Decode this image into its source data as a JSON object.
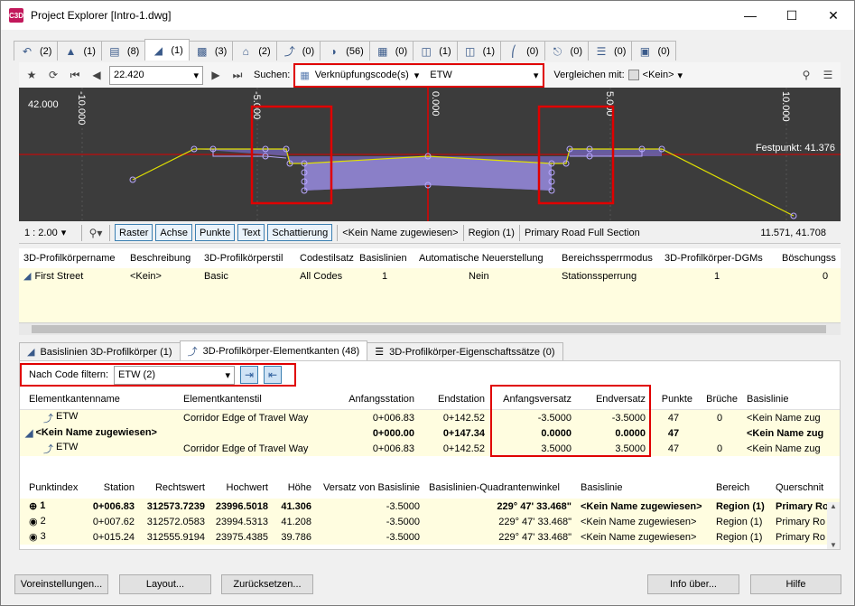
{
  "window": {
    "title": "Project Explorer [Intro-1.dwg]",
    "app_icon_text": "C3D"
  },
  "tabs": [
    {
      "icon": "alignment-icon",
      "count": "(2)"
    },
    {
      "icon": "profile-icon",
      "count": "(1)"
    },
    {
      "icon": "profile-view-icon",
      "count": "(8)"
    },
    {
      "icon": "corridor-icon",
      "count": "(1)"
    },
    {
      "icon": "assembly-icon",
      "count": "(3)"
    },
    {
      "icon": "surface-icon",
      "count": "(2)"
    },
    {
      "icon": "feature-line-icon",
      "count": "(0)"
    },
    {
      "icon": "point-icon",
      "count": "(56)"
    },
    {
      "icon": "parcel-icon",
      "count": "(0)"
    },
    {
      "icon": "pipe-network-icon",
      "count": "(1)"
    },
    {
      "icon": "pressure-network-icon",
      "count": "(1)"
    },
    {
      "icon": "sample-line-icon",
      "count": "(0)"
    },
    {
      "icon": "intersection-icon",
      "count": "(0)"
    },
    {
      "icon": "table-icon",
      "count": "(0)"
    },
    {
      "icon": "layer-icon",
      "count": "(0)"
    }
  ],
  "toolbar": {
    "station_value": "22.420",
    "search_label": "Suchen:",
    "search_mode": "Verknüpfungscode(s)",
    "search_value": "ETW",
    "compare_label": "Vergleichen mit:",
    "compare_value": "<Kein>"
  },
  "viewer": {
    "axis_labels": [
      "-10.000",
      "-5.000",
      "0.000",
      "5.000",
      "10.000"
    ],
    "elevation_label": "42.000",
    "fixpoint_label": "Festpunkt: 41.376"
  },
  "status": {
    "scale": "1 : 2.00",
    "buttons": [
      "Raster",
      "Achse",
      "Punkte",
      "Text",
      "Schattierung"
    ],
    "name": "<Kein Name zugewiesen>",
    "region": "Region (1)",
    "section": "Primary Road Full Section",
    "coords": "11.571, 41.708"
  },
  "corridor_table": {
    "headers": [
      "3D-Profilkörpername",
      "Beschreibung",
      "3D-Profilkörperstil",
      "Codestilsatz",
      "Basislinien",
      "Automatische Neuerstellung",
      "Bereichssperrmodus",
      "3D-Profilkörper-DGMs",
      "Böschungss"
    ],
    "rows": [
      [
        "First Street",
        "<Kein>",
        "Basic",
        "All Codes",
        "1",
        "Nein",
        "Stationssperrung",
        "1",
        "0"
      ]
    ]
  },
  "bottom_tabs": [
    {
      "label": "Basislinien 3D-Profilkörper (1)"
    },
    {
      "label": "3D-Profilkörper-Elementkanten (48)"
    },
    {
      "label": "3D-Profilkörper-Eigenschaftssätze (0)"
    }
  ],
  "filter": {
    "label": "Nach Code filtern:",
    "value": "ETW  (2)"
  },
  "edge_table": {
    "headers": [
      "Elementkantenname",
      "Elementkantenstil",
      "Anfangsstation",
      "Endstation",
      "Anfangsversatz",
      "Endversatz",
      "Punkte",
      "Brüche",
      "Basislinie"
    ],
    "rows": [
      [
        "ETW",
        "Corridor Edge of Travel Way",
        "0+006.83",
        "0+142.52",
        "-3.5000",
        "-3.5000",
        "47",
        "0",
        "<Kein Name zug"
      ],
      [
        "<Kein Name zugewiesen>",
        "",
        "0+000.00",
        "0+147.34",
        "0.0000",
        "0.0000",
        "47",
        "",
        "<Kein Name zug"
      ],
      [
        "ETW",
        "Corridor Edge of Travel Way",
        "0+006.83",
        "0+142.52",
        "3.5000",
        "3.5000",
        "47",
        "0",
        "<Kein Name zug"
      ]
    ]
  },
  "point_table": {
    "headers": [
      "Punktindex",
      "Station",
      "Rechtswert",
      "Hochwert",
      "Höhe",
      "Versatz von Basislinie",
      "Basislinien-Quadrantenwinkel",
      "Basislinie",
      "Bereich",
      "Querschnit"
    ],
    "rows": [
      [
        "1",
        "0+006.83",
        "312573.7239",
        "23996.5018",
        "41.306",
        "-3.5000",
        "229° 47' 33.468\"",
        "<Kein Name zugewiesen>",
        "Region (1)",
        "Primary Ro"
      ],
      [
        "2",
        "0+007.62",
        "312572.0583",
        "23994.5313",
        "41.208",
        "-3.5000",
        "229° 47' 33.468\"",
        "<Kein Name zugewiesen>",
        "Region (1)",
        "Primary Ro"
      ],
      [
        "3",
        "0+015.24",
        "312555.9194",
        "23975.4385",
        "39.786",
        "-3.5000",
        "229° 47' 33.468\"",
        "<Kein Name zugewiesen>",
        "Region (1)",
        "Primary Ro"
      ]
    ]
  },
  "footer": {
    "settings": "Voreinstellungen...",
    "layout": "Layout...",
    "reset": "Zurücksetzen...",
    "about": "Info über...",
    "help": "Hilfe"
  }
}
